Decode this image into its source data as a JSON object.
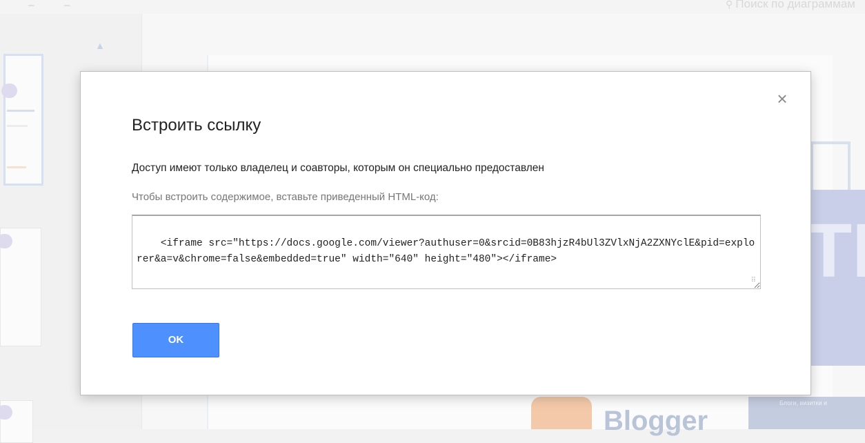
{
  "background": {
    "search_placeholder": "Поиск по диаграммам",
    "blogger_text": "Blogger",
    "side_text": "ТИ",
    "right_caption": "Блоги, визитки и"
  },
  "dialog": {
    "title": "Встроить ссылку",
    "access_text": "Доступ имеют только владелец и соавторы, которым он специально предоставлен",
    "hint_text": "Чтобы встроить содержимое, вставьте приведенный HTML-код:",
    "embed_code": "<iframe src=\"https://docs.google.com/viewer?authuser=0&srcid=0B83hjzR4bUl3ZVlxNjA2ZXNYclE&pid=explorer&a=v&chrome=false&embedded=true\" width=\"640\" height=\"480\"></iframe>",
    "ok_label": "OK",
    "close_glyph": "×"
  },
  "colors": {
    "primary_button": "#4d90fe",
    "primary_button_border": "#3079ed"
  }
}
